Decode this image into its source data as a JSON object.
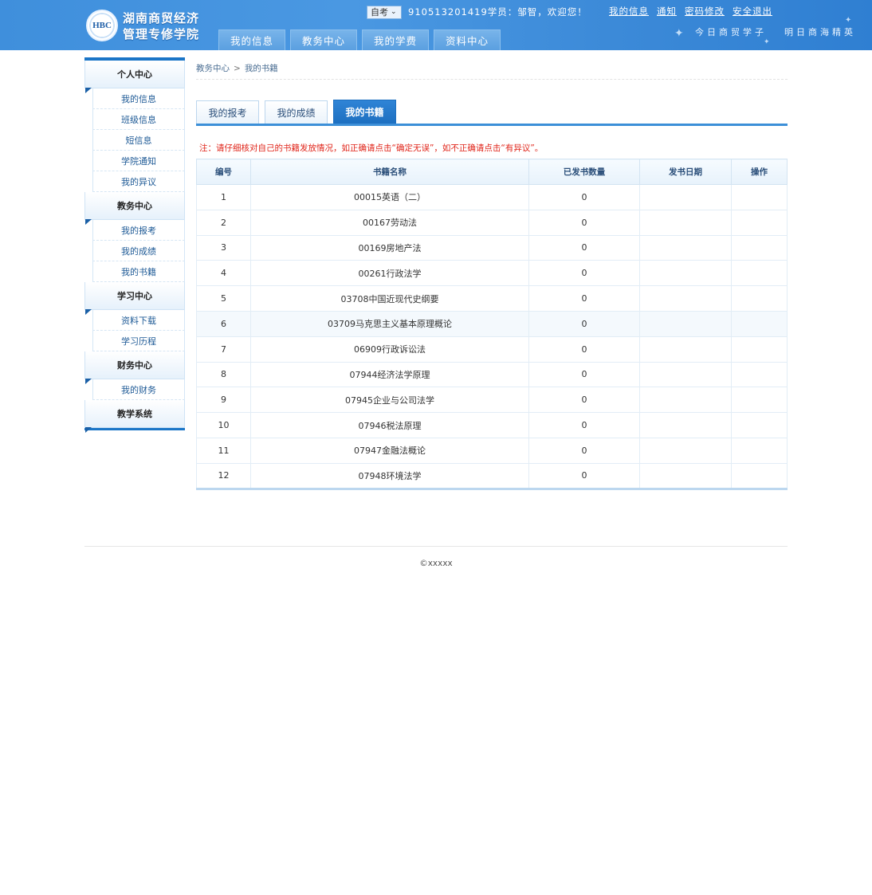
{
  "header": {
    "school_line1": "湖南商贸经济",
    "school_line2": "管理专修学院",
    "logo_badge": "HBC",
    "exam_type_selected": "自考",
    "welcome_text": "910513201419学员：邹智，欢迎您！",
    "links": [
      "我的信息",
      "通知",
      "密码修改",
      "安全退出"
    ],
    "slogan_left": "今日商贸学子",
    "slogan_right": "明日商海精英",
    "nav": [
      "我的信息",
      "教务中心",
      "我的学费",
      "资料中心"
    ]
  },
  "sidebar": {
    "groups": [
      {
        "title": "个人中心",
        "items": [
          "我的信息",
          "班级信息",
          "短信息",
          "学院通知",
          "我的异议"
        ]
      },
      {
        "title": "教务中心",
        "items": [
          "我的报考",
          "我的成绩",
          "我的书籍"
        ]
      },
      {
        "title": "学习中心",
        "items": [
          "资料下载",
          "学习历程"
        ]
      },
      {
        "title": "财务中心",
        "items": [
          "我的财务"
        ]
      },
      {
        "title": "教学系统",
        "items": []
      }
    ]
  },
  "breadcrumb": {
    "parent": "教务中心",
    "separator": ">",
    "current": "我的书籍"
  },
  "tabs": [
    {
      "label": "我的报考",
      "active": false
    },
    {
      "label": "我的成绩",
      "active": false
    },
    {
      "label": "我的书籍",
      "active": true
    }
  ],
  "note": "注：请仔细核对自己的书籍发放情况，如正确请点击“确定无误”，如不正确请点击“有异议”。",
  "table": {
    "headers": [
      "编号",
      "书籍名称",
      "已发书数量",
      "发书日期",
      "操作"
    ],
    "rows": [
      [
        "1",
        "00015英语（二）",
        "0",
        "",
        ""
      ],
      [
        "2",
        "00167劳动法",
        "0",
        "",
        ""
      ],
      [
        "3",
        "00169房地产法",
        "0",
        "",
        ""
      ],
      [
        "4",
        "00261行政法学",
        "0",
        "",
        ""
      ],
      [
        "5",
        "03708中国近现代史纲要",
        "0",
        "",
        ""
      ],
      [
        "6",
        "03709马克思主义基本原理概论",
        "0",
        "",
        ""
      ],
      [
        "7",
        "06909行政诉讼法",
        "0",
        "",
        ""
      ],
      [
        "8",
        "07944经济法学原理",
        "0",
        "",
        ""
      ],
      [
        "9",
        "07945企业与公司法学",
        "0",
        "",
        ""
      ],
      [
        "10",
        "07946税法原理",
        "0",
        "",
        ""
      ],
      [
        "11",
        "07947金融法概论",
        "0",
        "",
        ""
      ],
      [
        "12",
        "07948环境法学",
        "0",
        "",
        ""
      ]
    ]
  },
  "footer": {
    "copyright": "©xxxxx"
  },
  "colors": {
    "header_blue": "#3f8fdc",
    "accent": "#1a75c7",
    "note_red": "#e0261b"
  }
}
